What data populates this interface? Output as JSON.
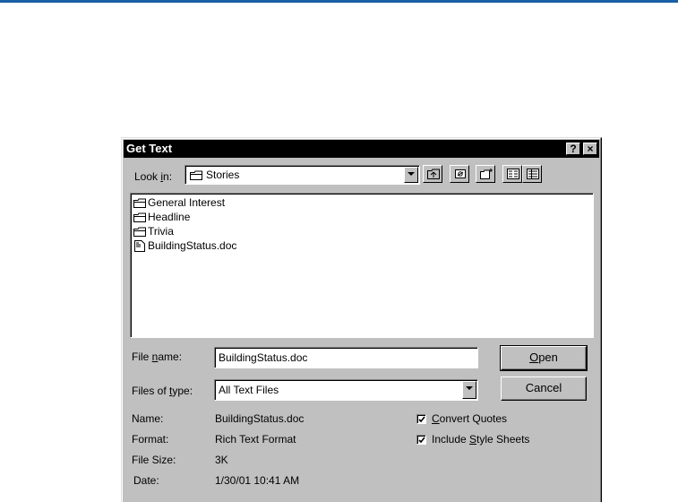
{
  "dialog": {
    "title": "Get Text",
    "help_button": "?",
    "close_button": "×"
  },
  "lookin": {
    "label_pre": "Look ",
    "label_access": "i",
    "label_post": "n:",
    "value": "Stories"
  },
  "toolbar": {
    "icons": [
      "up-one-level-icon",
      "desktop-icon",
      "new-folder-icon",
      "list-view-icon",
      "details-view-icon"
    ]
  },
  "files": [
    {
      "name": "General Interest",
      "type": "folder"
    },
    {
      "name": "Headline",
      "type": "folder"
    },
    {
      "name": "Trivia",
      "type": "folder"
    },
    {
      "name": "BuildingStatus.doc",
      "type": "document"
    }
  ],
  "filename": {
    "label_pre": "File ",
    "label_access": "n",
    "label_post": "ame:",
    "value": "BuildingStatus.doc"
  },
  "filetype": {
    "label_pre": "Files of ",
    "label_access": "t",
    "label_post": "ype:",
    "value": "All Text Files"
  },
  "buttons": {
    "open_access": "O",
    "open_rest": "pen",
    "cancel": "Cancel"
  },
  "info": {
    "name_label": "Name:",
    "name_value": "BuildingStatus.doc",
    "format_label": "Format:",
    "format_value": "Rich Text Format",
    "size_label": "File Size:",
    "size_value": "3K",
    "date_label": "Date:",
    "date_value": "1/30/01 10:41 AM"
  },
  "options": {
    "convert_access": "C",
    "convert_rest": "onvert Quotes",
    "convert_checked": true,
    "style_pre": "Include ",
    "style_access": "S",
    "style_post": "tyle Sheets",
    "style_checked": true
  },
  "colors": {
    "top_rule": "#1a5fa3",
    "dialog_face": "#c0c0c0",
    "titlebar": "#000000"
  }
}
